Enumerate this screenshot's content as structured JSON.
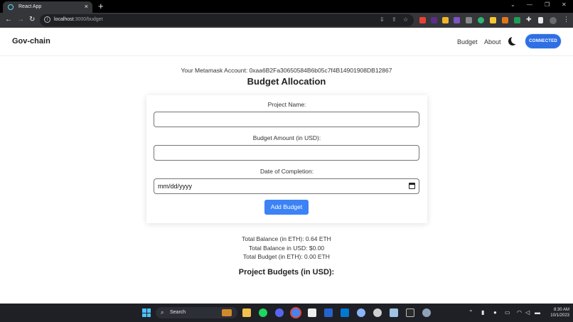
{
  "browser": {
    "tab_title": "React App",
    "tab_close": "×",
    "new_tab": "+",
    "url_host": "localhost",
    "url_path": ":3000/budget",
    "window_controls": [
      "⌄",
      "—",
      "❐",
      "✕"
    ]
  },
  "app": {
    "brand": "Gov-chain",
    "nav": {
      "budget": "Budget",
      "about": "About"
    },
    "connect_label": "CONNECTED"
  },
  "page": {
    "account_line": "Your Metamask Account: 0xaa6B2Fa30650584B6b05c7f4B14901908DB12867",
    "title": "Budget Allocation",
    "form": {
      "project_name_label": "Project Name:",
      "project_name_value": "",
      "budget_amount_label": "Budget Amount (in USD):",
      "budget_amount_value": "",
      "date_label": "Date of Completion:",
      "date_placeholder": "mm/dd/yyyy",
      "submit_label": "Add Budget"
    },
    "stats": {
      "balance_eth": "Total Balance (in ETH): 0.64 ETH",
      "balance_usd": "Total Balance in USD: $0.00",
      "budget_eth": "Total Budget (in ETH): 0.00 ETH"
    },
    "projects_heading": "Project Budgets (in USD):"
  },
  "taskbar": {
    "search_label": "Search",
    "time": "8:30 AM",
    "date": "10/1/2023"
  },
  "colors": {
    "accent": "#3b82f6",
    "connect": "#2f6fe4",
    "chrome_dark": "#35363a",
    "taskbar": "#1f2026"
  }
}
